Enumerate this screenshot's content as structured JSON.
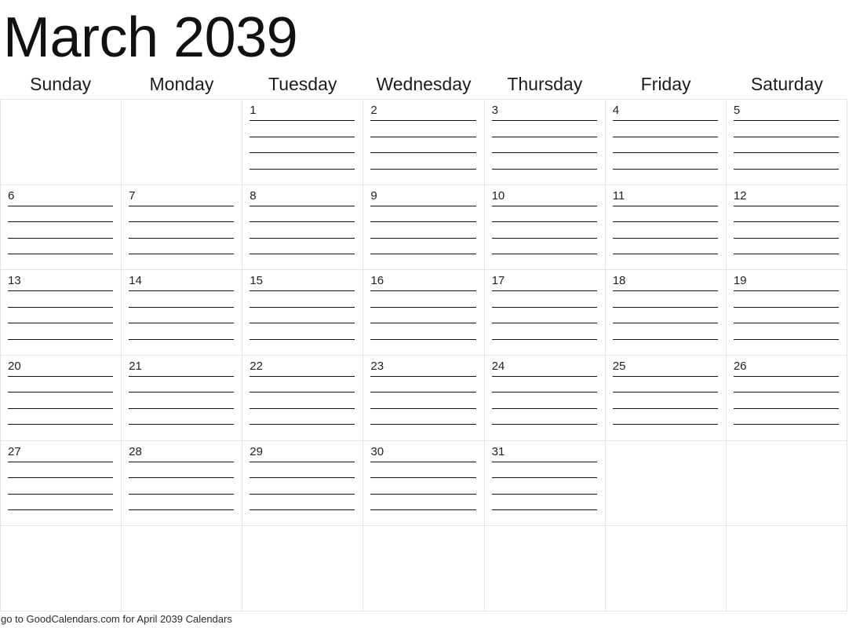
{
  "title": "March 2039",
  "month": "March",
  "year": "2039",
  "weekday_headers": [
    "Sunday",
    "Monday",
    "Tuesday",
    "Wednesday",
    "Thursday",
    "Friday",
    "Saturday"
  ],
  "grid": {
    "columns": 7,
    "rows": 6,
    "lines_per_day": 4,
    "cells": [
      {
        "day": "",
        "lines": 0
      },
      {
        "day": "",
        "lines": 0
      },
      {
        "day": "1",
        "lines": 4
      },
      {
        "day": "2",
        "lines": 4
      },
      {
        "day": "3",
        "lines": 4
      },
      {
        "day": "4",
        "lines": 4
      },
      {
        "day": "5",
        "lines": 4
      },
      {
        "day": "6",
        "lines": 4
      },
      {
        "day": "7",
        "lines": 4
      },
      {
        "day": "8",
        "lines": 4
      },
      {
        "day": "9",
        "lines": 4
      },
      {
        "day": "10",
        "lines": 4
      },
      {
        "day": "11",
        "lines": 4
      },
      {
        "day": "12",
        "lines": 4
      },
      {
        "day": "13",
        "lines": 4
      },
      {
        "day": "14",
        "lines": 4
      },
      {
        "day": "15",
        "lines": 4
      },
      {
        "day": "16",
        "lines": 4
      },
      {
        "day": "17",
        "lines": 4
      },
      {
        "day": "18",
        "lines": 4
      },
      {
        "day": "19",
        "lines": 4
      },
      {
        "day": "20",
        "lines": 4
      },
      {
        "day": "21",
        "lines": 4
      },
      {
        "day": "22",
        "lines": 4
      },
      {
        "day": "23",
        "lines": 4
      },
      {
        "day": "24",
        "lines": 4
      },
      {
        "day": "25",
        "lines": 4
      },
      {
        "day": "26",
        "lines": 4
      },
      {
        "day": "27",
        "lines": 4
      },
      {
        "day": "28",
        "lines": 4
      },
      {
        "day": "29",
        "lines": 4
      },
      {
        "day": "30",
        "lines": 4
      },
      {
        "day": "31",
        "lines": 4
      },
      {
        "day": "",
        "lines": 0
      },
      {
        "day": "",
        "lines": 0
      },
      {
        "day": "",
        "lines": 0
      },
      {
        "day": "",
        "lines": 0
      },
      {
        "day": "",
        "lines": 0
      },
      {
        "day": "",
        "lines": 0
      },
      {
        "day": "",
        "lines": 0
      },
      {
        "day": "",
        "lines": 0
      },
      {
        "day": "",
        "lines": 0
      }
    ]
  },
  "footer": {
    "text": "go to GoodCalendars.com for April 2039 Calendars"
  },
  "colors": {
    "background": "#ffffff",
    "grid_border": "#e3e3e3",
    "rule_line": "#111111",
    "title_text": "#111111",
    "day_number_text": "#222222",
    "footer_text": "#2b2b2b"
  }
}
